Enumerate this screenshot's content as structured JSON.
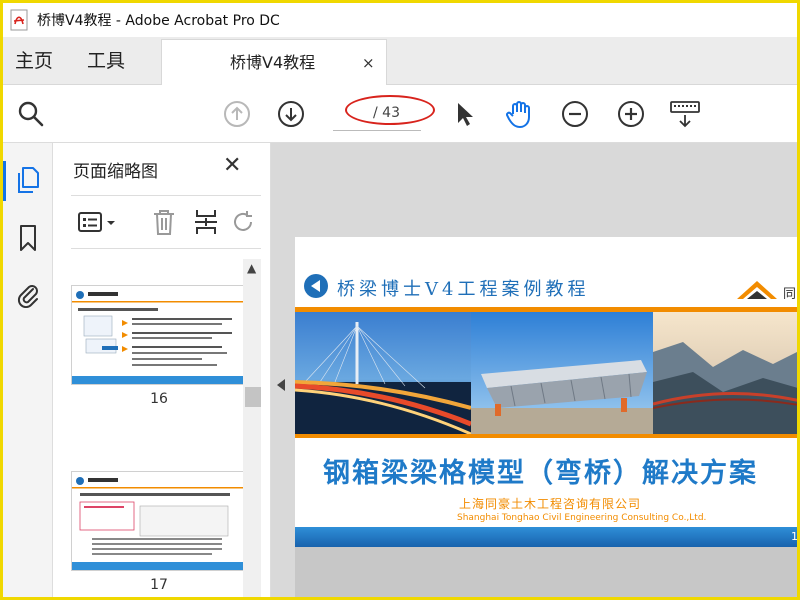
{
  "window": {
    "title": "桥博V4教程 - Adobe Acrobat Pro DC"
  },
  "tabs": {
    "home": "主页",
    "tools": "工具",
    "document": "桥博V4教程",
    "close_glyph": "×"
  },
  "toolbar": {
    "page_input_value": "",
    "page_total": "/ 43",
    "icons": [
      "search-icon",
      "prev-page-icon",
      "next-page-icon",
      "select-cursor-icon",
      "hand-tool-icon",
      "zoom-out-icon",
      "zoom-in-icon",
      "keyboard-icon"
    ]
  },
  "sidebar": {
    "panel_title": "页面缩略图",
    "close_glyph": "✕",
    "thumbnails": [
      {
        "page_label": "16"
      },
      {
        "page_label": "17"
      }
    ]
  },
  "document": {
    "header_title": "桥梁博士V4工程案例教程",
    "logo_text": "同",
    "main_title": "钢箱梁梁格模型（弯桥）解决方案",
    "company_cn": "上海同豪土木工程咨询有限公司",
    "company_en": "Shanghai Tonghao Civil Engineering Consulting Co.,Ltd.",
    "footer_page": "1"
  },
  "colors": {
    "accent_blue": "#1473e6",
    "annotation_red": "#d8231c",
    "doc_blue": "#1f7ac8",
    "doc_orange": "#f28c00",
    "outer_border": "#f0d800"
  }
}
